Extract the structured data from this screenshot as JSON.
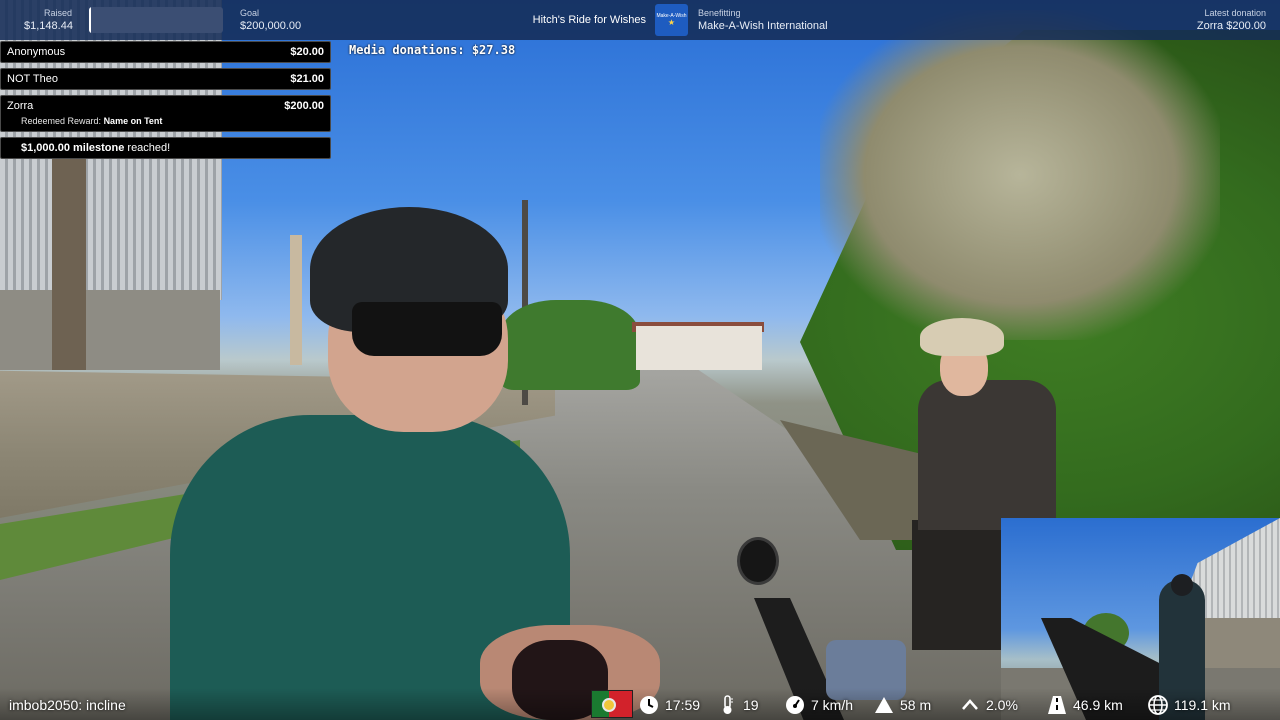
{
  "topbar": {
    "raised_label": "Raised",
    "raised_value": "$1,148.44",
    "goal_label": "Goal",
    "goal_value": "$200,000.00",
    "progress_fraction": 0.00574,
    "event_title": "Hitch's Ride for Wishes",
    "logo_text": "Make-A-Wish",
    "benefit_label": "Benefitting",
    "benefit_value": "Make-A-Wish International",
    "latest_label": "Latest donation",
    "latest_value": "Zorra $200.00"
  },
  "feed": {
    "items": [
      {
        "name": "Anonymous",
        "amount": "$20.00"
      },
      {
        "name": "NOT Theo",
        "amount": "$21.00"
      },
      {
        "name": "Zorra",
        "amount": "$200.00",
        "sub_prefix": "Redeemed Reward:",
        "sub_reward": "Name on Tent"
      }
    ],
    "milestone_amount": "$1,000.00 milestone",
    "milestone_suffix": "reached!"
  },
  "media_donations": "Media donations: $27.38",
  "hud": {
    "chat_command": "imbob2050: incline",
    "country_flag": "portugal-flag",
    "time": "17:59",
    "temperature": "19",
    "speed": "7 km/h",
    "altitude": "58 m",
    "incline": "2.0%",
    "distance_today": "46.9 km",
    "distance_total": "119.1 km"
  },
  "icons": {
    "time": "clock-icon",
    "temperature": "thermometer-icon",
    "speed": "speedometer-icon",
    "altitude": "mountain-icon",
    "incline": "chevron-up-icon",
    "distance_today": "road-icon",
    "distance_total": "globe-icon"
  },
  "colors": {
    "topbar": "#152c56",
    "feed_background": "#000000",
    "progress_fill": "#ffffff"
  }
}
